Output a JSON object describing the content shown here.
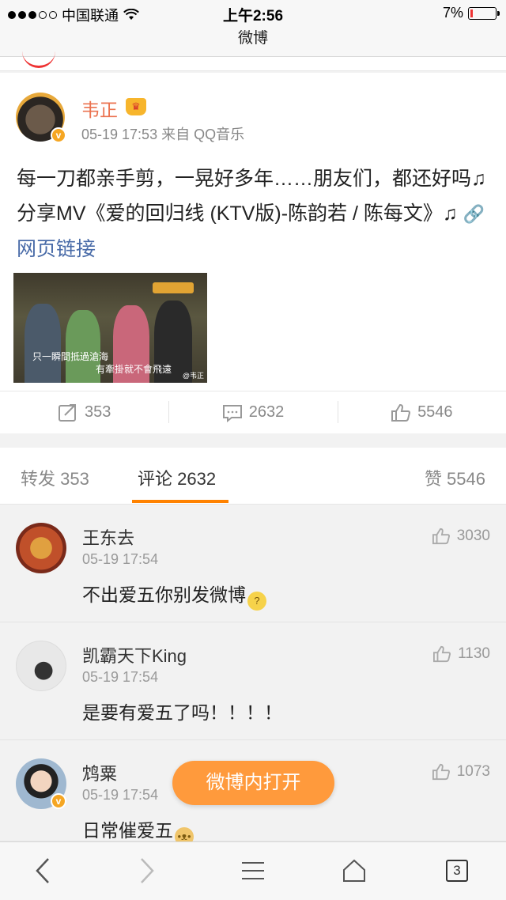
{
  "status_bar": {
    "carrier": "中国联通",
    "time": "上午2:56",
    "battery_percent": "7%",
    "battery_level": 0.07,
    "signal_bars_filled": 3
  },
  "nav": {
    "title": "微博"
  },
  "post": {
    "author": "韦正",
    "verified": "v",
    "meta": "05-19 17:53 来自 QQ音乐",
    "text_main": "每一刀都亲手剪，一晃好多年……朋友们，都还好吗♫分享MV《爱的回归线 (KTV版)-陈韵若 / 陈每文》♫",
    "link_text": "网页链接",
    "thumbnail": {
      "subtitle_1": "只一瞬間抵過滄海",
      "subtitle_2": "有牽掛就不會飛遠",
      "watermark": "@韦正"
    },
    "actions": {
      "repost_count": "353",
      "comment_count": "2632",
      "like_count": "5546"
    }
  },
  "tabs": {
    "repost": "转发 353",
    "comment": "评论 2632",
    "like": "赞 5546"
  },
  "comments": [
    {
      "name": "王东去",
      "time": "05-19 17:54",
      "text": "不出爱五你别发微博",
      "likes": "3030",
      "verified": false
    },
    {
      "name": "凯霸天下King",
      "time": "05-19 17:54",
      "text": "是要有爱五了吗！！！！",
      "likes": "1130",
      "verified": false
    },
    {
      "name": "鸩粟",
      "time": "05-19 17:54",
      "text": "日常催爱五",
      "likes": "1073",
      "verified": true
    }
  ],
  "open_in_app": "微博内打开",
  "toolbar": {
    "tab_count": "3"
  },
  "colors": {
    "accent": "#ff8200",
    "name_orange": "#eb7350",
    "link_blue": "#496ba8"
  }
}
